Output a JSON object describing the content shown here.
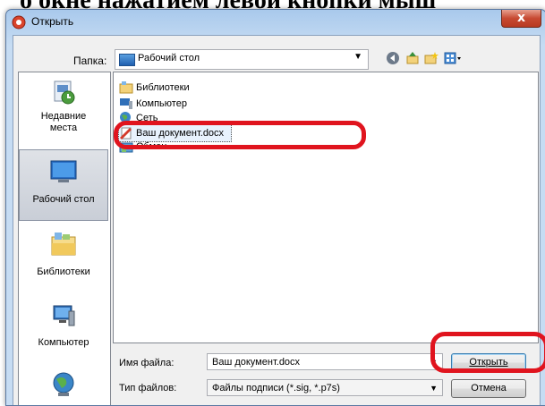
{
  "background": {
    "caption": "о окне нажатием левой кнопки мыш"
  },
  "window": {
    "title": "Открыть",
    "close_label": "x"
  },
  "toolbar": {
    "folder_label": "Папка:",
    "folder_value": "Рабочий стол",
    "icons": [
      "back-icon",
      "up-folder-icon",
      "new-folder-icon",
      "view-menu-icon"
    ]
  },
  "places": [
    {
      "label": "Недавние места",
      "icon": "recent-places-icon"
    },
    {
      "label": "Рабочий стол",
      "icon": "desktop-icon",
      "selected": true
    },
    {
      "label": "Библиотеки",
      "icon": "libraries-icon"
    },
    {
      "label": "Компьютер",
      "icon": "computer-icon"
    },
    {
      "label": "",
      "icon": "network-icon"
    }
  ],
  "files": [
    {
      "name": "Библиотеки",
      "icon": "libraries-icon"
    },
    {
      "name": "Компьютер",
      "icon": "computer-icon"
    },
    {
      "name": "Сеть",
      "icon": "network-icon"
    },
    {
      "name": "Ваш документ.docx",
      "icon": "word-document-icon",
      "selected": true
    },
    {
      "name": "Обмен",
      "icon": "shared-folder-icon"
    }
  ],
  "filename": {
    "label": "Имя файла:",
    "value": "Ваш документ.docx"
  },
  "filetype": {
    "label": "Тип файлов:",
    "value": "Файлы подписи (*.sig, *.p7s)"
  },
  "buttons": {
    "open": "Открыть",
    "cancel": "Отмена"
  },
  "colors": {
    "highlight": "#e0141e",
    "accent": "#3c7fb1"
  }
}
